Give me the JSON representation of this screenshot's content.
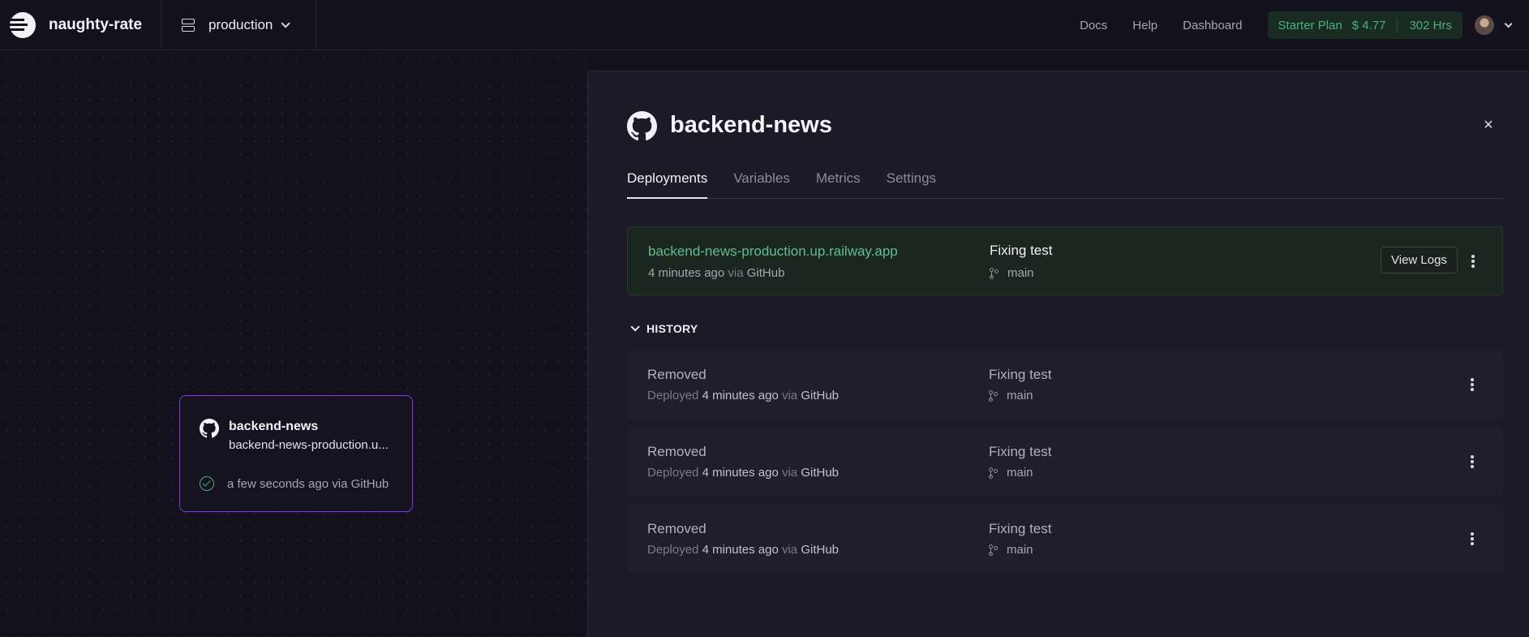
{
  "app": {
    "project_name": "naughty-rate",
    "environment": "production"
  },
  "topnav": {
    "docs": "Docs",
    "help": "Help",
    "dashboard": "Dashboard",
    "plan_name": "Starter Plan",
    "plan_cost": "$ 4.77",
    "plan_hours": "302 Hrs"
  },
  "canvas": {
    "service": {
      "name": "backend-news",
      "url": "backend-news-production.up.railway.app",
      "url_display": "backend-news-production.u...",
      "status": "a few seconds ago via GitHub"
    }
  },
  "panel": {
    "title": "backend-news",
    "close": "×",
    "tabs": [
      "Deployments",
      "Variables",
      "Metrics",
      "Settings"
    ],
    "active_tab": "Deployments",
    "active_deployment": {
      "url": "backend-news-production.up.railway.app",
      "time": "4 minutes ago",
      "via": "via",
      "source": "GitHub",
      "message": "Fixing test",
      "branch": "main",
      "view_logs": "View Logs"
    },
    "history_label": "HISTORY",
    "history": [
      {
        "status": "Removed",
        "deployed": "Deployed",
        "time": "4 minutes ago",
        "via": "via",
        "source": "GitHub",
        "message": "Fixing test",
        "branch": "main"
      },
      {
        "status": "Removed",
        "deployed": "Deployed",
        "time": "4 minutes ago",
        "via": "via",
        "source": "GitHub",
        "message": "Fixing test",
        "branch": "main"
      },
      {
        "status": "Removed",
        "deployed": "Deployed",
        "time": "4 minutes ago",
        "via": "via",
        "source": "GitHub",
        "message": "Fixing test",
        "branch": "main"
      }
    ]
  },
  "colors": {
    "accent_green": "#5fbf8c",
    "card_border": "#7c3aed",
    "background": "#13111c"
  },
  "icons": {
    "logo": "railway-logo-icon",
    "environment": "server-stack-icon",
    "service": "github-icon",
    "status": "check-circle-icon",
    "branch": "git-branch-icon",
    "menu": "kebab-menu-icon",
    "close": "close-icon"
  }
}
